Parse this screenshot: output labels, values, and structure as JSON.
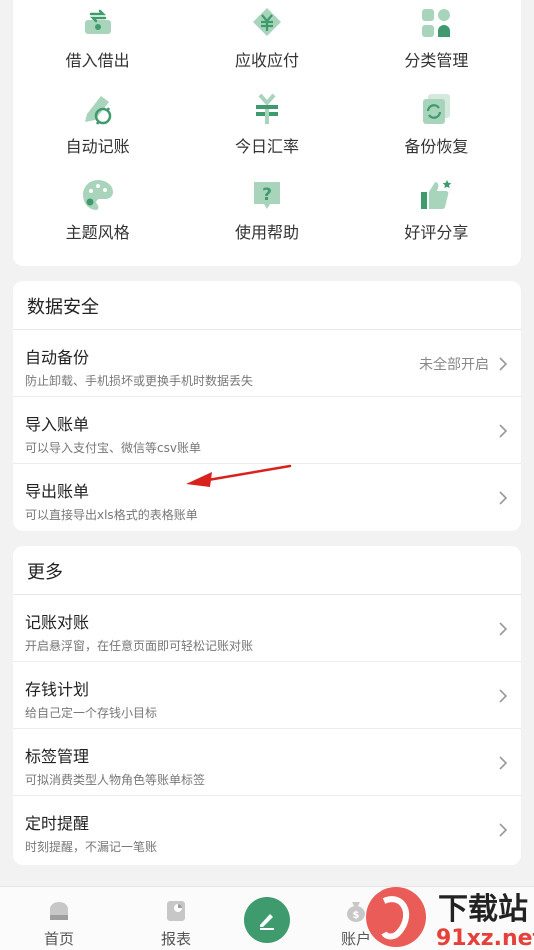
{
  "tools": [
    {
      "label": "借入借出",
      "icon": "exchange-money-icon"
    },
    {
      "label": "应收应付",
      "icon": "yuan-receivable-icon"
    },
    {
      "label": "分类管理",
      "icon": "category-grid-icon"
    },
    {
      "label": "自动记账",
      "icon": "auto-record-icon"
    },
    {
      "label": "今日汇率",
      "icon": "exchange-rate-icon"
    },
    {
      "label": "备份恢复",
      "icon": "backup-restore-icon"
    },
    {
      "label": "主题风格",
      "icon": "palette-icon"
    },
    {
      "label": "使用帮助",
      "icon": "help-icon"
    },
    {
      "label": "好评分享",
      "icon": "thumbs-up-icon"
    }
  ],
  "security": {
    "title": "数据安全",
    "rows": [
      {
        "title": "自动备份",
        "subtitle": "防止卸载、手机损坏或更换手机时数据丢失",
        "value": "未全部开启"
      },
      {
        "title": "导入账单",
        "subtitle": "可以导入支付宝、微信等csv账单"
      },
      {
        "title": "导出账单",
        "subtitle": "可以直接导出xls格式的表格账单"
      }
    ]
  },
  "more": {
    "title": "更多",
    "rows": [
      {
        "title": "记账对账",
        "subtitle": "开启悬浮窗，在任意页面即可轻松记账对账"
      },
      {
        "title": "存钱计划",
        "subtitle": "给自己定一个存钱小目标"
      },
      {
        "title": "标签管理",
        "subtitle": "可拟消费类型人物角色等账单标签"
      },
      {
        "title": "定时提醒",
        "subtitle": "时刻提醒，不漏记一笔账"
      }
    ]
  },
  "nav": {
    "home": "首页",
    "report": "报表",
    "account": "账户"
  },
  "watermark": {
    "cn": "下载站",
    "en": "91xz.net"
  },
  "colors": {
    "accent": "#3f9a6e",
    "icon_light": "#a9d4bc",
    "arrow": "#d9211e"
  }
}
